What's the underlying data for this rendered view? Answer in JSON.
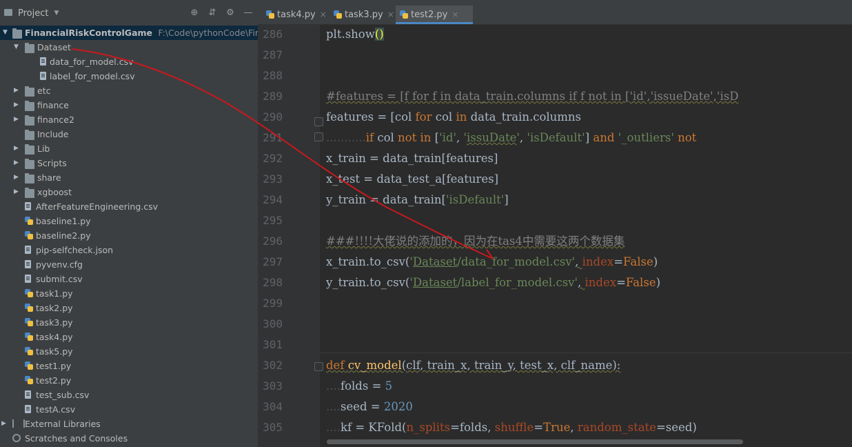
{
  "project_panel": {
    "title": "Project",
    "root": {
      "name": "FinancialRiskControlGame",
      "path": "F:\\Code\\pythonCode\\Financia"
    },
    "items": [
      {
        "label": "Dataset",
        "kind": "folder",
        "depth": 1,
        "expanded": true
      },
      {
        "label": "data_for_model.csv",
        "kind": "file",
        "depth": 2
      },
      {
        "label": "label_for_model.csv",
        "kind": "file",
        "depth": 2
      },
      {
        "label": "etc",
        "kind": "folder",
        "depth": 1
      },
      {
        "label": "finance",
        "kind": "folder",
        "depth": 1
      },
      {
        "label": "finance2",
        "kind": "folder",
        "depth": 1
      },
      {
        "label": "Include",
        "kind": "folder",
        "depth": 1,
        "no_arrow": true
      },
      {
        "label": "Lib",
        "kind": "folder",
        "depth": 1
      },
      {
        "label": "Scripts",
        "kind": "folder",
        "depth": 1
      },
      {
        "label": "share",
        "kind": "folder",
        "depth": 1
      },
      {
        "label": "xgboost",
        "kind": "folder",
        "depth": 1
      },
      {
        "label": "AfterFeatureEngineering.csv",
        "kind": "file",
        "depth": 1
      },
      {
        "label": "baseline1.py",
        "kind": "py",
        "depth": 1
      },
      {
        "label": "baseline2.py",
        "kind": "py",
        "depth": 1
      },
      {
        "label": "pip-selfcheck.json",
        "kind": "file",
        "depth": 1
      },
      {
        "label": "pyvenv.cfg",
        "kind": "file",
        "depth": 1
      },
      {
        "label": "submit.csv",
        "kind": "file",
        "depth": 1
      },
      {
        "label": "task1.py",
        "kind": "py",
        "depth": 1
      },
      {
        "label": "task2.py",
        "kind": "py",
        "depth": 1
      },
      {
        "label": "task3.py",
        "kind": "py",
        "depth": 1
      },
      {
        "label": "task4.py",
        "kind": "py",
        "depth": 1
      },
      {
        "label": "task5.py",
        "kind": "py",
        "depth": 1
      },
      {
        "label": "test1.py",
        "kind": "py",
        "depth": 1
      },
      {
        "label": "test2.py",
        "kind": "py",
        "depth": 1
      },
      {
        "label": "test_sub.csv",
        "kind": "file",
        "depth": 1
      },
      {
        "label": "testA.csv",
        "kind": "file",
        "depth": 1
      },
      {
        "label": "External Libraries",
        "kind": "lib",
        "depth": 0
      },
      {
        "label": "Scratches and Consoles",
        "kind": "scratch",
        "depth": 0
      }
    ]
  },
  "tabs": [
    {
      "label": "task4.py",
      "active": false
    },
    {
      "label": "task3.py",
      "active": false
    },
    {
      "label": "test2.py",
      "active": true
    }
  ],
  "line_numbers": [
    "286",
    "287",
    "288",
    "289",
    "290",
    "291",
    "292",
    "293",
    "294",
    "295",
    "296",
    "297",
    "298",
    "299",
    "300",
    "301",
    "302",
    "303",
    "304",
    "305"
  ],
  "code": {
    "l286": {
      "a": "plt.show",
      "b": "()"
    },
    "l289": "#features = [f for f in data_train.columns if f not in ['id','issueDate','isD",
    "l290": {
      "a": "features = [col ",
      "kw1": "for",
      "b": " col ",
      "kw2": "in",
      "c": " data_train.columns"
    },
    "l291": {
      "dots": "...........",
      "kw1": "if",
      "b": " col ",
      "kw2": "not in",
      "c": " [",
      "s1": "'id'",
      "d": ", ",
      "s2a": "'",
      "s2b": "issuDate",
      "s2c": "'",
      "e": ", ",
      "s3": "'isDefault'",
      "f": "] ",
      "kw3": "and",
      "g": " ",
      "s4": "'_outliers'",
      "h": " ",
      "kw4": "not"
    },
    "l292": "x_train = data_train[features]",
    "l293": "x_test = data_test_a[features]",
    "l294": {
      "a": "y_train = data_train[",
      "s": "'isDefault'",
      "b": "]"
    },
    "l296": "###!!!!大佬说的添加的，因为在tas4中需要这两个数据集",
    "l297": {
      "a": "x_train.to_csv(",
      "s1": "'",
      "s2": "Dataset",
      "s3": "/data_for_model.csv'",
      "b": ", ",
      "p": "index",
      "c": "=",
      "k": "False",
      "d": ")"
    },
    "l298": {
      "a": "y_train.to_csv(",
      "s1": "'",
      "s2": "Dataset",
      "s3": "/label_for_model.csv'",
      "b": ", ",
      "p": "index",
      "c": "=",
      "k": "False",
      "d": ")"
    },
    "l302": {
      "kw": "def",
      "sp": " ",
      "fn": "cv_model",
      "a": "(clf, train_x, train_y, test_x, clf_name):"
    },
    "l303": {
      "dots": "....",
      "a": "folds = ",
      "n": "5"
    },
    "l304": {
      "dots": "....",
      "a": "seed = ",
      "n": "2020"
    },
    "l305": {
      "dots": "....",
      "a": "kf = KFold(",
      "p1": "n_splits",
      "b": "=folds, ",
      "p2": "shuffle",
      "c": "=",
      "k": "True",
      "d": ", ",
      "p3": "random_state",
      "e": "=seed)"
    }
  }
}
